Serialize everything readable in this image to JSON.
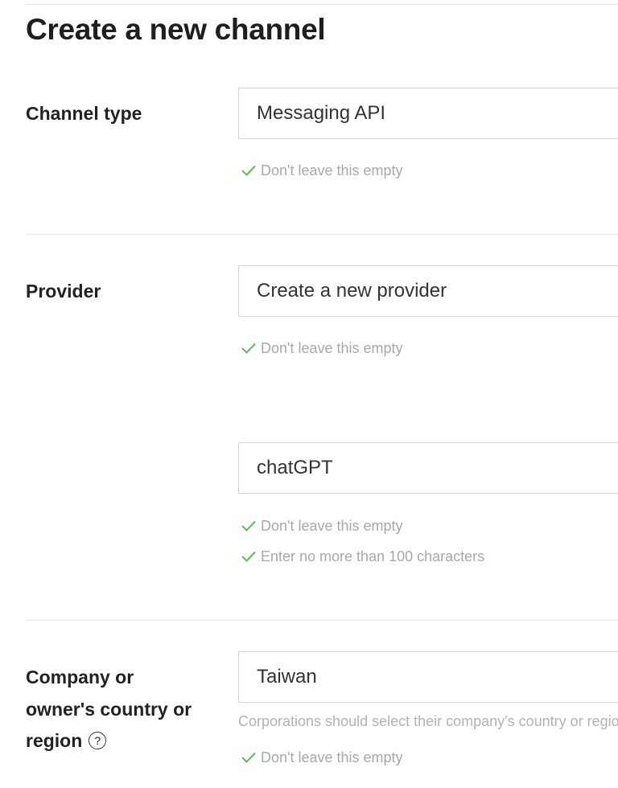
{
  "page": {
    "title": "Create a new channel"
  },
  "channel_type": {
    "label": "Channel type",
    "value": "Messaging API",
    "validations": [
      "Don't leave this empty"
    ]
  },
  "provider": {
    "label": "Provider",
    "value": "Create a new provider",
    "validations": [
      "Don't leave this empty"
    ],
    "new_provider_name": {
      "value": "chatGPT",
      "validations": [
        "Don't leave this empty",
        "Enter no more than 100 characters"
      ]
    }
  },
  "country": {
    "label_lines": [
      "Company or",
      "owner's country or",
      "region"
    ],
    "help_icon_glyph": "?",
    "value": "Taiwan",
    "note": "Corporations should select their company's country or region",
    "validations": [
      "Don't leave this empty"
    ]
  },
  "icons": {
    "valid_check": "check-icon",
    "help": "question-circle-icon"
  },
  "colors": {
    "valid_check": "#5cbb5c",
    "border": "#d5d5d5",
    "muted_text": "#a8a8a8"
  }
}
